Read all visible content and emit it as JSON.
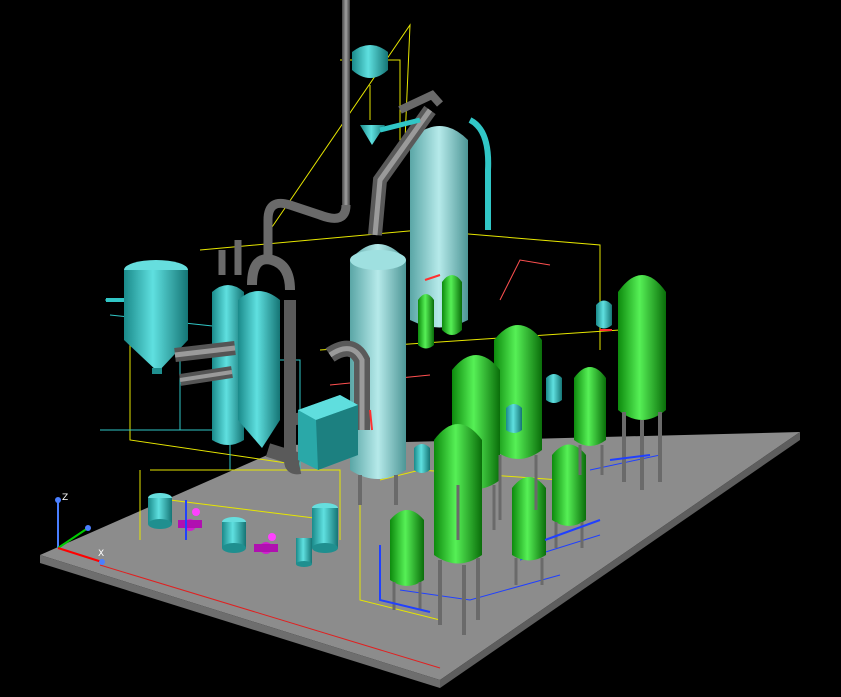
{
  "viewport": {
    "background": "#000000"
  },
  "colors": {
    "floor": "#8c8c8c",
    "floor_edge": "#6e6e6e",
    "cyan": "#31c6c6",
    "cyan_dark": "#1f8f8f",
    "cyan_light": "#7fe6e6",
    "teal_pale": "#8fd6d6",
    "green": "#18c018",
    "green_dark": "#0c7a0c",
    "green_light": "#6cf06c",
    "gray_pipe": "#7a7a7a",
    "gray_dark": "#4a4a4a",
    "magenta": "#d020d0",
    "yellow_line": "#e6e600",
    "blue_line": "#2040ff",
    "red_line": "#e02020",
    "axis_x": "#ff0000",
    "axis_y": "#00cc00",
    "axis_z": "#4a7fff"
  },
  "ucs_icon": {
    "z_label": "Z",
    "x_label": "X"
  },
  "equipment": {
    "green_vessel_count": 11,
    "cyan_vessel_count": 9
  }
}
